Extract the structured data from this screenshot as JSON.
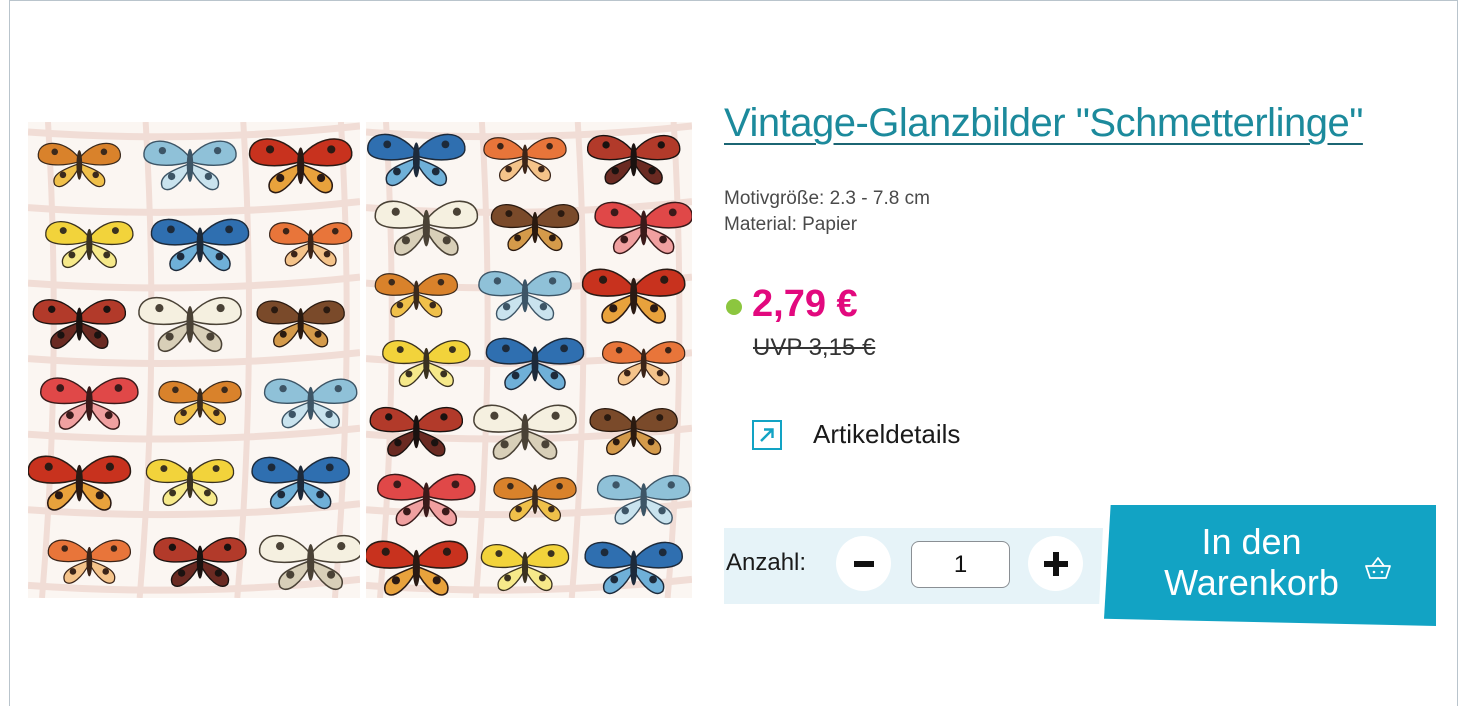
{
  "product": {
    "title": "Vintage-Glanzbilder \"Schmetterlinge\"",
    "size_line": "Motivgröße: 2.3 - 7.8 cm",
    "material_line": "Material: Papier",
    "price": "2,79 €",
    "uvp": "UVP 3,15 €",
    "availability_color": "#8cc63f"
  },
  "details_link": {
    "label": "Artikeldetails",
    "icon": "external-arrow-icon"
  },
  "quantity": {
    "label": "Anzahl:",
    "value": "1",
    "minus_icon": "minus-icon",
    "plus_icon": "plus-icon"
  },
  "cart": {
    "label_line1": "In den",
    "label_line2": "Warenkorb",
    "icon": "basket-icon"
  },
  "image": {
    "subject": "sheets of vintage butterfly scraps"
  },
  "colors": {
    "title": "#1c8a9c",
    "price": "#e2097e",
    "accent": "#12a3c4",
    "available": "#8cc63f"
  }
}
